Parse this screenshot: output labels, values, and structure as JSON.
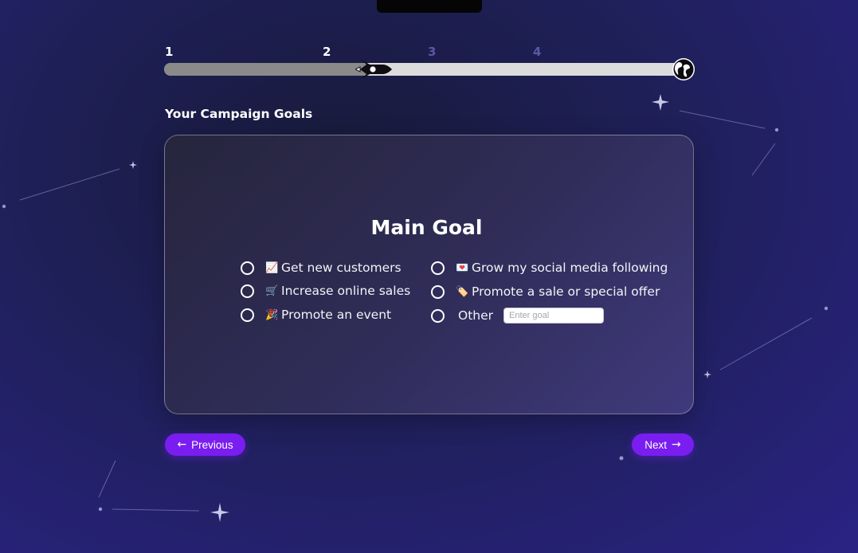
{
  "progress": {
    "steps": [
      "1",
      "2",
      "3",
      "4"
    ],
    "current_step": 2,
    "fill_fraction": 0.39,
    "rocket_icon": "rocket-icon",
    "goal_icon": "globe-icon"
  },
  "section_title": "Your Campaign Goals",
  "card": {
    "heading": "Main Goal",
    "options_left": [
      {
        "emoji": "📈",
        "label": "Get new customers"
      },
      {
        "emoji": "🛒",
        "label": "Increase online sales"
      },
      {
        "emoji": "🎉",
        "label": "Promote an event"
      }
    ],
    "options_right": [
      {
        "emoji": "💌",
        "label": "Grow my social media following"
      },
      {
        "emoji": "🏷️",
        "label": "Promote a sale or special offer"
      },
      {
        "emoji": "",
        "label": "Other"
      }
    ],
    "other_input": {
      "value": "",
      "placeholder": "Enter goal"
    }
  },
  "buttons": {
    "previous": "Previous",
    "next": "Next"
  },
  "colors": {
    "accent": "#7a1df0",
    "background": "#2a2384",
    "progress_fill": "#8a8a8a",
    "progress_track": "#dcdcdc"
  }
}
